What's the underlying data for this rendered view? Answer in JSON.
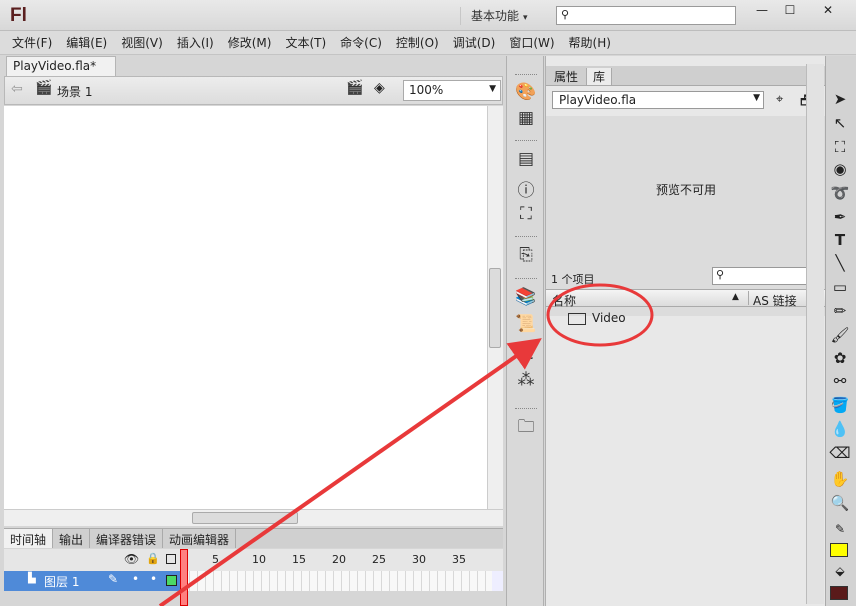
{
  "window": {
    "logo": "Fl",
    "workspace": "基本功能",
    "search_placeholder": ""
  },
  "menu": [
    "文件(F)",
    "编辑(E)",
    "视图(V)",
    "插入(I)",
    "修改(M)",
    "文本(T)",
    "命令(C)",
    "控制(O)",
    "调试(D)",
    "窗口(W)",
    "帮助(H)"
  ],
  "document": {
    "tab_label": "PlayVideo.fla*",
    "scene_label": "场景 1",
    "zoom": "100%"
  },
  "timeline": {
    "tabs": [
      "时间轴",
      "输出",
      "编译器错误",
      "动画编辑器"
    ],
    "frame_numbers": [
      "1",
      "5",
      "10",
      "15",
      "20",
      "25",
      "30",
      "35"
    ],
    "layer_name": "图层 1"
  },
  "panel": {
    "tabs": [
      "属性",
      "库"
    ],
    "library_file": "PlayVideo.fla",
    "preview_text": "预览不可用",
    "item_count": "1 个项目",
    "col_name": "名称",
    "col_linkage": "AS 链接",
    "items": [
      {
        "name": "Video",
        "icon": "video-symbol-icon"
      }
    ]
  },
  "colors": {
    "annotation": "#e8393a",
    "layer_selected": "#4f8ad8",
    "stroke_swatch": "#ffff00",
    "fill_swatch": "#5a1a1a"
  }
}
